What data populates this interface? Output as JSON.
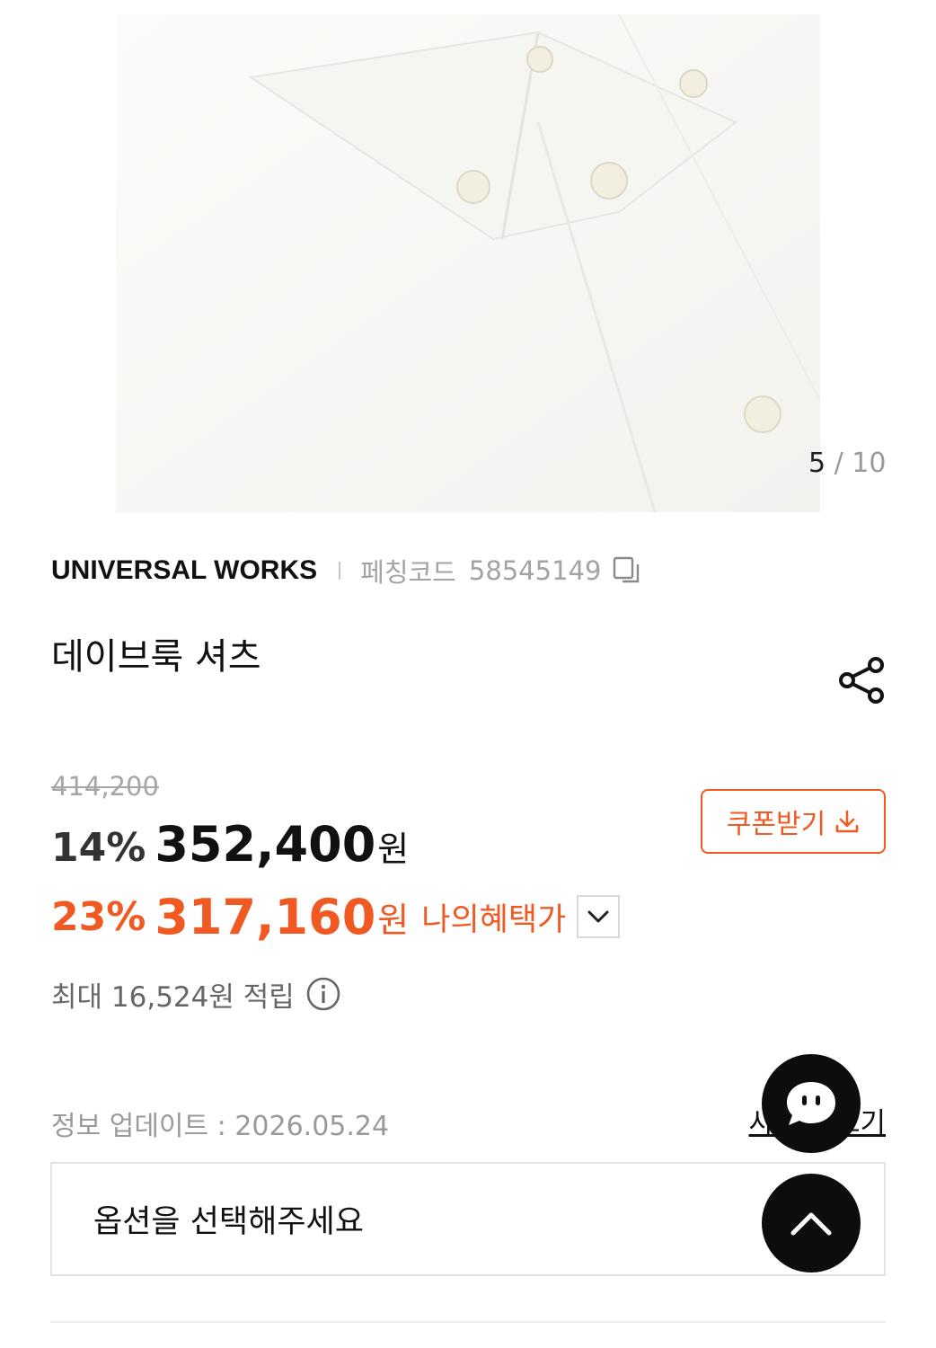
{
  "gallery": {
    "current": "5",
    "separator": " / ",
    "total": "10"
  },
  "product": {
    "brand": "UNIVERSAL WORKS",
    "code_label": "페칭코드",
    "code_value": "58545149",
    "title": "데이브룩 셔츠"
  },
  "pricing": {
    "original_price": "414,200",
    "discount_rate": "14%",
    "sale_price": "352,400",
    "currency_unit": "원",
    "benefit_rate": "23%",
    "benefit_price": "317,160",
    "benefit_label": "나의혜택가",
    "points_text": "최대 16,524원 적립"
  },
  "coupon": {
    "label": "쿠폰받기"
  },
  "info": {
    "update_text": "정보 업데이트 : 2026.05.24",
    "size_link_label": "사이즈 보기"
  },
  "options": {
    "placeholder": "옵션을 선택해주세요"
  },
  "colors": {
    "accent": "#f05a22",
    "text_primary": "#111111",
    "text_muted": "#9a9a9a",
    "fab_background": "#0d0d0d"
  },
  "icons": {
    "copy": "copy-icon",
    "share": "share-icon",
    "download": "download-icon",
    "chevron": "chevron-down-icon",
    "info": "info-icon",
    "chat": "chat-icon",
    "scroll_top": "chevron-up-icon"
  }
}
